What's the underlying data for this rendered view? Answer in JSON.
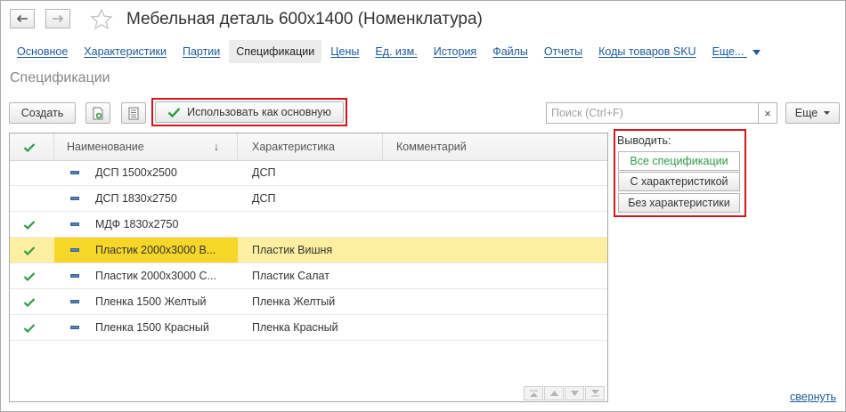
{
  "window": {
    "title": "Мебельная деталь 600х1400 (Номенклатура)",
    "back_icon": "arrow-left-icon",
    "forward_icon": "arrow-right-icon",
    "favorite_icon": "star-icon"
  },
  "tabs": [
    {
      "label": "Основное",
      "active": false
    },
    {
      "label": "Характеристики",
      "active": false
    },
    {
      "label": "Партии",
      "active": false
    },
    {
      "label": "Спецификации",
      "active": true
    },
    {
      "label": "Цены",
      "active": false
    },
    {
      "label": "Ед. изм.",
      "active": false
    },
    {
      "label": "История",
      "active": false
    },
    {
      "label": "Файлы",
      "active": false
    },
    {
      "label": "Отчеты",
      "active": false
    },
    {
      "label": "Коды товаров SKU",
      "active": false
    }
  ],
  "tabs_more": "Еще...",
  "section_title": "Спецификации",
  "toolbar": {
    "create_label": "Создать",
    "use_as_main_label": "Использовать как основную",
    "more_label": "Еще",
    "search_placeholder": "Поиск (Ctrl+F)",
    "search_clear": "×"
  },
  "table": {
    "columns": {
      "name": "Наименование",
      "sort_indicator": "↓",
      "characteristic": "Характеристика",
      "comment": "Комментарий"
    },
    "rows": [
      {
        "main": false,
        "name": "ДСП 1500х2500",
        "characteristic": "ДСП",
        "comment": "",
        "selected": false
      },
      {
        "main": false,
        "name": "ДСП 1830х2750",
        "characteristic": "ДСП",
        "comment": "",
        "selected": false
      },
      {
        "main": true,
        "name": "МДФ 1830х2750",
        "characteristic": "",
        "comment": "",
        "selected": false
      },
      {
        "main": true,
        "name": "Пластик 2000х3000 В...",
        "characteristic": "Пластик Вишня",
        "comment": "",
        "selected": true
      },
      {
        "main": true,
        "name": "Пластик 2000х3000 С...",
        "characteristic": "Пластик Салат",
        "comment": "",
        "selected": false
      },
      {
        "main": true,
        "name": "Пленка 1500 Желтый",
        "characteristic": "Пленка Желтый",
        "comment": "",
        "selected": false
      },
      {
        "main": true,
        "name": "Пленка 1500 Красный",
        "characteristic": "Пленка Красный",
        "comment": "",
        "selected": false
      }
    ]
  },
  "filter": {
    "label": "Выводить:",
    "options": [
      {
        "label": "Все спецификации",
        "active": true
      },
      {
        "label": "С характеристикой",
        "active": false
      },
      {
        "label": "Без характеристики",
        "active": false
      }
    ]
  },
  "collapse_label": "свернуть",
  "colors": {
    "accent_link": "#1c5a9a",
    "check_green": "#2f9a48",
    "highlight_red": "#d6151b",
    "selected_row": "#fcefa1",
    "selected_cell": "#f7d62a"
  }
}
